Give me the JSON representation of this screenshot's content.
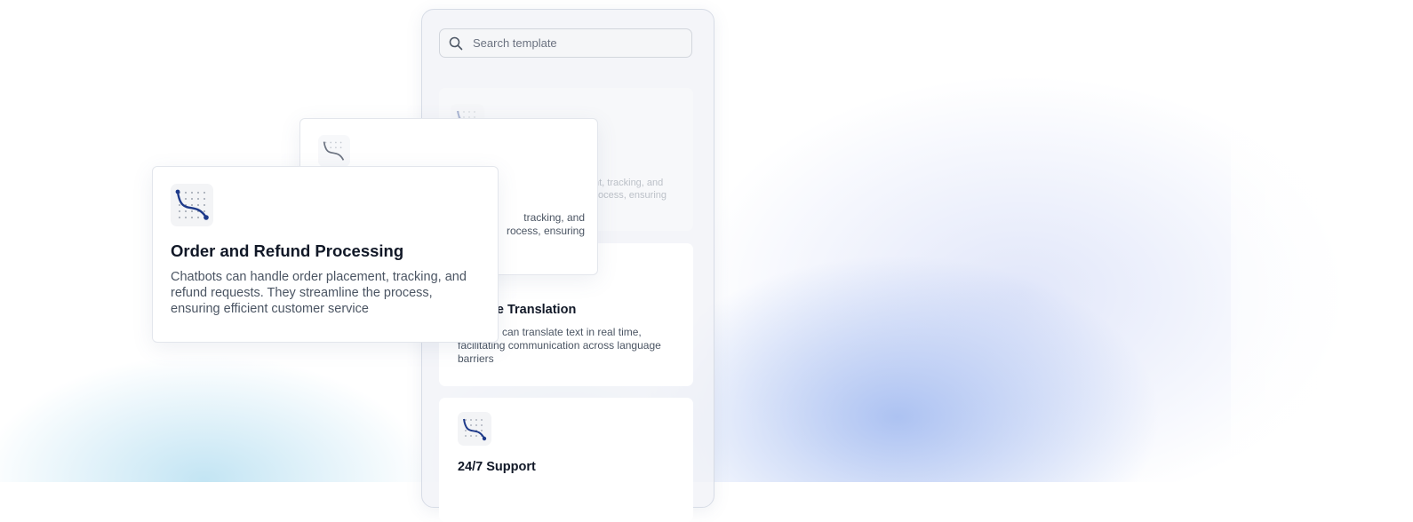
{
  "search": {
    "placeholder": "Search template",
    "icon": "search-icon"
  },
  "template_cards": [
    {
      "title": "Order and Refund Processing",
      "visible_title": "g",
      "visible_desc_lines": [
        "nt, tracking, and",
        "e process, ensuring"
      ],
      "faded": true
    },
    {
      "title": "Language Translation",
      "visible_title": "ge Translation",
      "visible_desc_lines": [
        "can translate text in real time,",
        "facilitating communication across language",
        "barriers"
      ]
    },
    {
      "title": "24/7 Support"
    }
  ],
  "floating_back": {
    "visible_desc_lines": [
      "tracking, and",
      "rocess, ensuring"
    ]
  },
  "floating_front": {
    "title": "Order and Refund Processing",
    "description": "Chatbots can handle order placement, tracking, and refund requests. They streamline the process, ensuring efficient customer service"
  },
  "colors": {
    "icon_accent": "#1e3a8a",
    "title_text": "#111827",
    "body_text": "#4b5563"
  }
}
